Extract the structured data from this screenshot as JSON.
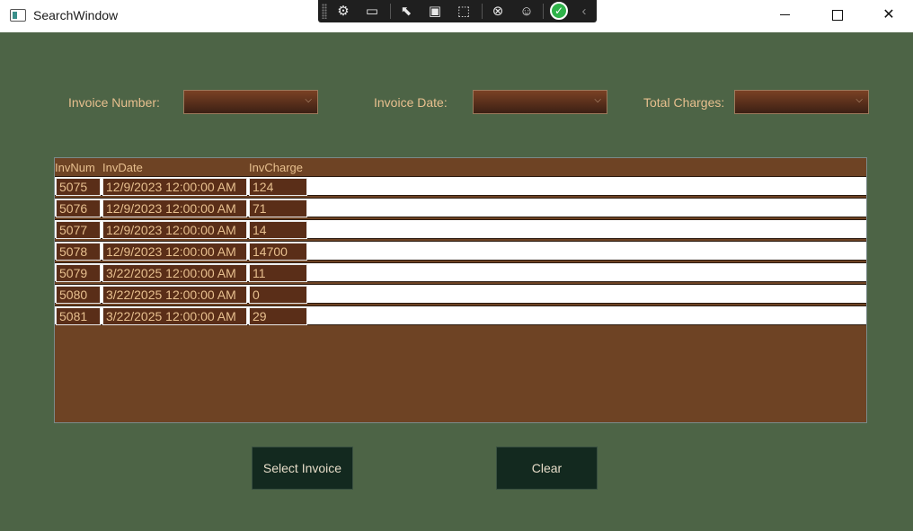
{
  "window": {
    "title": "SearchWindow"
  },
  "debug_toolbar": {
    "icons": [
      "select-element-icon",
      "video-icon",
      "pointer-icon",
      "layout-icon",
      "track-focus-icon",
      "binding-icon",
      "accessibility-icon",
      "check-icon",
      "collapse-chevron-icon"
    ]
  },
  "filters": {
    "invoice_number_label": "Invoice Number:",
    "invoice_date_label": "Invoice Date:",
    "total_charges_label": "Total Charges:"
  },
  "grid": {
    "headers": [
      "InvNum",
      "InvDate",
      "InvCharge"
    ],
    "rows": [
      [
        "5075",
        "12/9/2023 12:00:00 AM",
        "124"
      ],
      [
        "5076",
        "12/9/2023 12:00:00 AM",
        "71"
      ],
      [
        "5077",
        "12/9/2023 12:00:00 AM",
        "14"
      ],
      [
        "5078",
        "12/9/2023 12:00:00 AM",
        "14700"
      ],
      [
        "5079",
        "3/22/2025 12:00:00 AM",
        "11"
      ],
      [
        "5080",
        "3/22/2025 12:00:00 AM",
        "0"
      ],
      [
        "5081",
        "3/22/2025 12:00:00 AM",
        "29"
      ]
    ]
  },
  "buttons": {
    "select": "Select Invoice",
    "clear": "Clear"
  },
  "colors": {
    "background": "#4d6446",
    "grid": "#6e4324",
    "cell": "#5a2e18",
    "accent_text": "#e7bf8e",
    "button": "#13291f"
  }
}
